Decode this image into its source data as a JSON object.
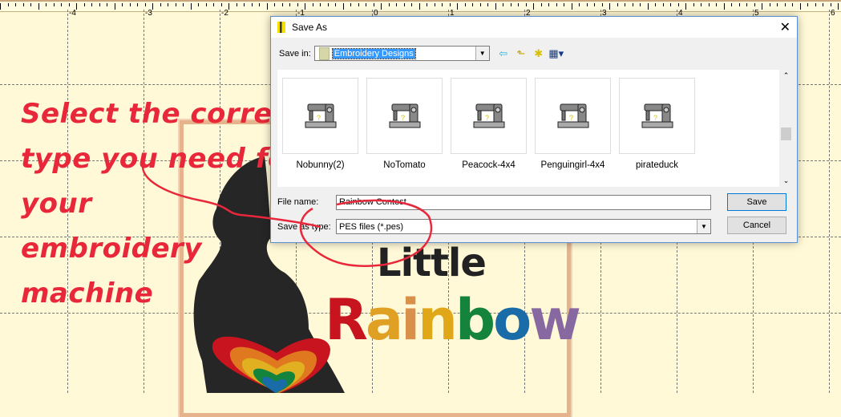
{
  "ruler": {
    "labels": [
      "-4",
      "-3",
      "-2",
      "-1",
      "0",
      "1",
      "2",
      "3",
      "4",
      "5",
      "6"
    ]
  },
  "annotation": {
    "lines": [
      "Select the correct",
      "type you need for",
      "your",
      "embroidery",
      "machine"
    ],
    "color": "#e8283a"
  },
  "design": {
    "line1": "Little",
    "line2_letters": [
      {
        "ch": "R",
        "color": "#c8141e"
      },
      {
        "ch": "a",
        "color": "#e0a024"
      },
      {
        "ch": "i",
        "color": "#d8904a"
      },
      {
        "ch": "n",
        "color": "#e0a818"
      },
      {
        "ch": "b",
        "color": "#14843c"
      },
      {
        "ch": "o",
        "color": "#1a6ca8"
      },
      {
        "ch": "w",
        "color": "#8868a0"
      }
    ]
  },
  "dialog": {
    "title": "Save As",
    "close_icon": "close-icon",
    "save_in_label": "Save in:",
    "save_in_value": "Embroidery Designs",
    "files": [
      "Nobunny(2)",
      "NoTomato",
      "Peacock-4x4",
      "Penguingirl-4x4",
      "pirateduck"
    ],
    "file_name_label": "File name:",
    "file_name_value": "Rainbow Contest",
    "type_label": "Save as type:",
    "type_value": "PES files (*.pes)",
    "save_button": "Save",
    "cancel_button": "Cancel"
  }
}
